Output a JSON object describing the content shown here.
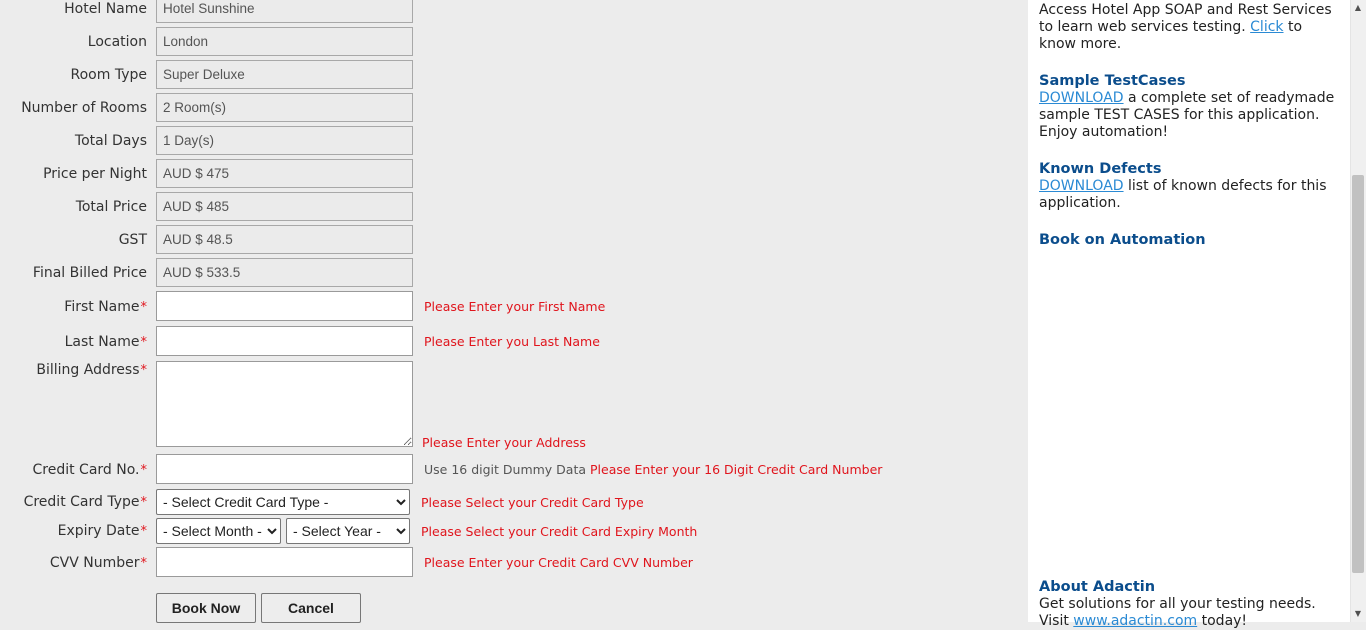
{
  "form": {
    "readonly_fields": [
      {
        "label": "Hotel Name",
        "value": "Hotel Sunshine"
      },
      {
        "label": "Location",
        "value": "London"
      },
      {
        "label": "Room Type",
        "value": "Super Deluxe"
      },
      {
        "label": "Number of Rooms",
        "value": "2 Room(s)"
      },
      {
        "label": "Total Days",
        "value": "1 Day(s)"
      },
      {
        "label": "Price per Night",
        "value": "AUD $ 475"
      },
      {
        "label": "Total Price",
        "value": "AUD $ 485"
      },
      {
        "label": "GST",
        "value": "AUD $ 48.5"
      },
      {
        "label": "Final Billed Price",
        "value": "AUD $ 533.5"
      }
    ],
    "required_mark": "*",
    "first_name": {
      "label": "First Name",
      "value": "",
      "error": "Please Enter your First Name"
    },
    "last_name": {
      "label": "Last Name",
      "value": "",
      "error": "Please Enter you Last Name"
    },
    "billing_address": {
      "label": "Billing Address",
      "value": "",
      "error": "Please Enter your Address"
    },
    "credit_card_no": {
      "label": "Credit Card No.",
      "value": "",
      "hint": "Use 16 digit Dummy Data",
      "error": "Please Enter your 16 Digit Credit Card Number"
    },
    "credit_card_type": {
      "label": "Credit Card Type",
      "selected": "- Select Credit Card Type -",
      "error": "Please Select your Credit Card Type"
    },
    "expiry_date": {
      "label": "Expiry Date",
      "month_selected": "- Select Month -",
      "year_selected": "- Select Year -",
      "error": "Please Select your Credit Card Expiry Month"
    },
    "cvv": {
      "label": "CVV Number",
      "value": "",
      "error": "Please Enter your Credit Card CVV Number"
    },
    "book_now_label": "Book Now",
    "cancel_label": "Cancel"
  },
  "sidebar": {
    "services": {
      "text_before": "Access Hotel App SOAP and Rest Services to learn web services testing.",
      "link": "Click",
      "text_after": "to know more."
    },
    "sample_testcases": {
      "title": "Sample TestCases",
      "link": "DOWNLOAD",
      "text": "a complete set of readymade sample TEST CASES for this application. Enjoy automation!"
    },
    "known_defects": {
      "title": "Known Defects",
      "link": "DOWNLOAD",
      "text": "list of known defects for this application."
    },
    "book_on_automation": {
      "title": "Book on Automation"
    },
    "about": {
      "title": "About Adactin",
      "text": "Get solutions for all your testing needs.",
      "visit_text": "Visit",
      "link": "www.adactin.com",
      "visit_after": "today!"
    }
  },
  "colors": {
    "error": "#e0141c",
    "sidebar_title": "#0b4d8c",
    "link": "#2a8ad4",
    "page_bg": "#ececec"
  },
  "icons": {
    "scroll_up": "triangle-up",
    "scroll_down": "triangle-down"
  }
}
